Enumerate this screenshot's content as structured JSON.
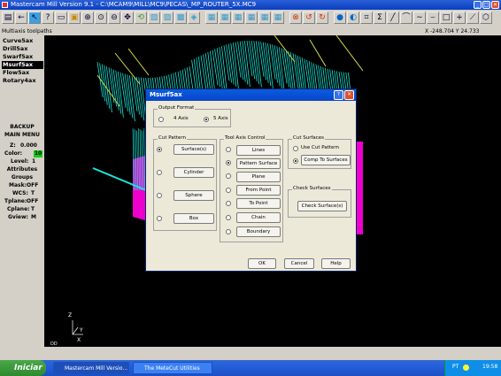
{
  "window": {
    "title": "Mastercam Mill Version 9.1 - C:\\MCAM9\\MILL\\MC9\\PECAS\\_MP_ROUTER_5X.MC9",
    "minimize": "_",
    "maximize": "□",
    "close": "✕"
  },
  "statusline": {
    "mode": "Multiaxis toolpaths",
    "coords": "X -248.704   Y 24.733"
  },
  "menu": {
    "items": [
      "Curve5ax",
      "Drill5ax",
      "Swarf5ax",
      "Msurf5ax",
      "Flow5ax",
      "Rotary4ax"
    ],
    "backup": "BACKUP",
    "main_menu": "MAIN MENU"
  },
  "status": {
    "z_label": "Z:",
    "z_value": "0.000",
    "color_label": "Color:",
    "color_value": "10",
    "level_label": "Level:",
    "level_value": "1",
    "attributes": "Attributes",
    "groups": "Groups",
    "mask_label": "Mask:",
    "mask_value": "OFF",
    "wcs_label": "WCS:",
    "wcs_value": "T",
    "tplane_label": "Tplane:",
    "tplane_value": "OFF",
    "cplane_label": "Cplane:",
    "cplane_value": "T",
    "gview_label": "Gview:",
    "gview_value": "M"
  },
  "viewport": {
    "axis_z": "Z",
    "axis_x": "X",
    "axis_y": "Y",
    "sm": "DD"
  },
  "dialog": {
    "title": "Msurf5ax",
    "help_q": "?",
    "close": "✕",
    "output_format": {
      "label": "Output Format",
      "opt1": "4 Axis",
      "opt2": "5 Axis",
      "selected": "5 Axis"
    },
    "cut_pattern": {
      "label": "Cut Pattern",
      "buttons": [
        "Surface(s)",
        "Cylinder",
        "Sphere",
        "Box"
      ],
      "selected": "Surface(s)"
    },
    "tool_axis": {
      "label": "Tool Axis Control",
      "buttons": [
        "Lines",
        "Pattern Surface",
        "Plane",
        "From Point",
        "To Point",
        "Chain",
        "Boundary"
      ],
      "selected": "Pattern Surface"
    },
    "cut_surfaces": {
      "label": "Cut Surfaces",
      "opt1": "Use Cut Pattern",
      "opt2": "Comp To Surfaces",
      "selected": "Comp To Surfaces"
    },
    "check_surfaces": {
      "label": "Check Surfaces",
      "button": "Check Surface(s)"
    },
    "ok": "OK",
    "cancel": "Cancel",
    "help": "Help"
  },
  "taskbar": {
    "start": "Iniciar",
    "tasks": [
      "Mastercam Mill Versio...",
      "The MeteCut Utilities"
    ],
    "lang": "PT",
    "clock": "19:58"
  },
  "colors": {
    "toolpath": "#19e6dc",
    "part": "#ee00cc",
    "dialog_title": "#0a5ce0",
    "taskbar": "#245edb"
  }
}
